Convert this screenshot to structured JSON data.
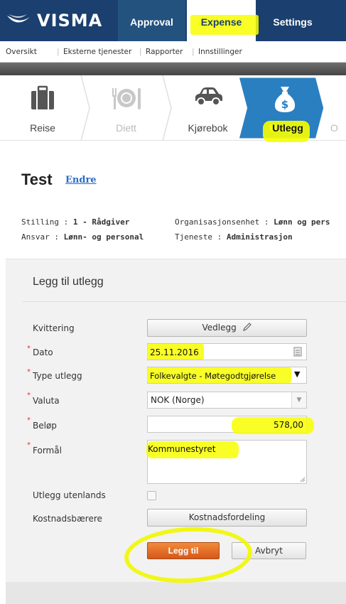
{
  "topnav": {
    "logo_text": "VISMA",
    "tabs": [
      "Approval",
      "Expense",
      "Settings"
    ],
    "active_tab": "Expense"
  },
  "subnav": {
    "items": [
      "Oversikt",
      "Eksterne tjenester",
      "Rapporter",
      "Innstillinger"
    ]
  },
  "steps": {
    "items": [
      {
        "label": "Reise",
        "icon": "suitcase-icon",
        "state": "normal"
      },
      {
        "label": "Diett",
        "icon": "plate-cutlery-icon",
        "state": "disabled"
      },
      {
        "label": "Kjørebok",
        "icon": "car-icon",
        "state": "normal"
      },
      {
        "label": "Utlegg",
        "icon": "money-bag-icon",
        "state": "active"
      },
      {
        "label": "O",
        "state": "disabled"
      }
    ]
  },
  "header": {
    "title": "Test",
    "edit_link": "Endre"
  },
  "info": {
    "stilling_label": "Stilling :",
    "stilling_value": "1 - Rådgiver",
    "org_label": "Organisasjonsenhet :",
    "org_value": "Lønn og pers",
    "ansvar_label": "Ansvar :",
    "ansvar_value": "Lønn- og personal",
    "tjeneste_label": "Tjeneste :",
    "tjeneste_value": "Administrasjon"
  },
  "form": {
    "title": "Legg til utlegg",
    "kvittering_label": "Kvittering",
    "vedlegg_button": "Vedlegg",
    "dato_label": "Dato",
    "dato_value": "25.11.2016",
    "type_label": "Type utlegg",
    "type_value": "Folkevalgte - Møtegodtgjørelse",
    "valuta_label": "Valuta",
    "valuta_value": "NOK (Norge)",
    "belop_label": "Beløp",
    "belop_value": "578,00",
    "formal_label": "Formål",
    "formal_value": "Kommunestyret",
    "utenlands_label": "Utlegg utenlands",
    "utenlands_checked": false,
    "kostnad_label": "Kostnadsbærere",
    "kostnad_button": "Kostnadsfordeling",
    "submit_button": "Legg til",
    "cancel_button": "Avbryt",
    "required_marker": "*"
  },
  "colors": {
    "nav_bg": "#1b3f6e",
    "accent_orange": "#e0702a",
    "active_step": "#2a7fc1",
    "highlight": "#f8ff00"
  }
}
